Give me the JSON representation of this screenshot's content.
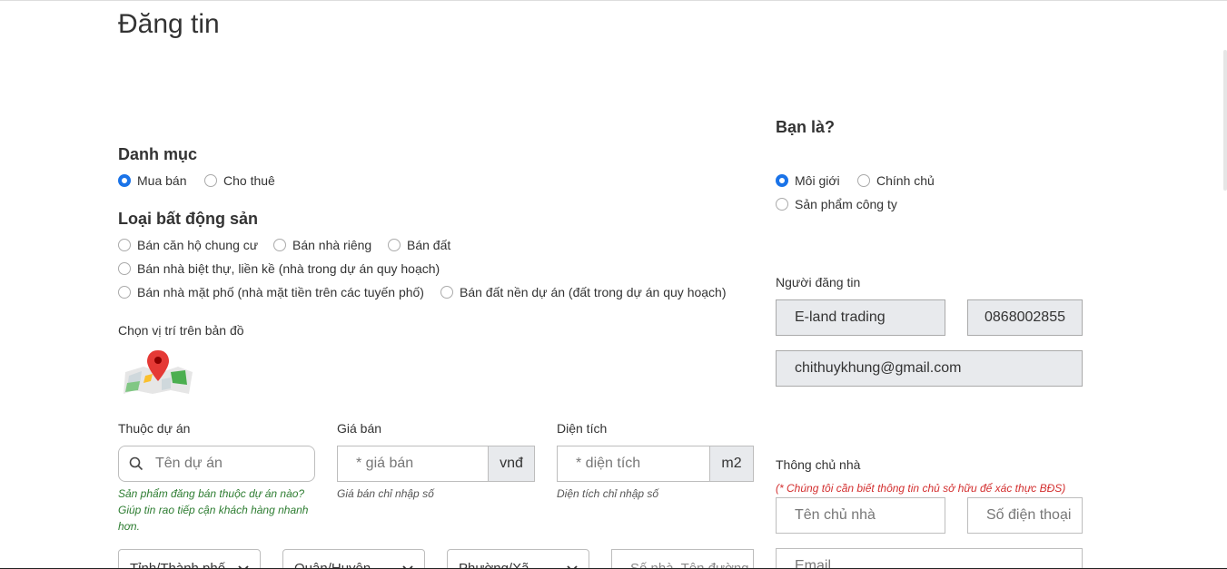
{
  "page": {
    "title": "Đăng tin"
  },
  "category": {
    "heading": "Danh mục",
    "options": [
      {
        "label": "Mua bán",
        "checked": true
      },
      {
        "label": "Cho thuê",
        "checked": false
      }
    ]
  },
  "property_type": {
    "heading": "Loại bất động sản",
    "options": [
      {
        "label": "Bán căn hộ chung cư",
        "checked": false
      },
      {
        "label": "Bán nhà riêng",
        "checked": false
      },
      {
        "label": "Bán đất",
        "checked": false
      },
      {
        "label": "Bán nhà biệt thự, liền kề (nhà trong dự án quy hoạch)",
        "checked": false
      },
      {
        "label": "Bán nhà mặt phố (nhà mặt tiền trên các tuyến phố)",
        "checked": false
      },
      {
        "label": "Bán đất nền dự án (đất trong dự án quy hoạch)",
        "checked": false
      }
    ]
  },
  "map": {
    "label": "Chọn vị trí trên bản đồ",
    "icon": "map-pin-icon"
  },
  "project": {
    "label": "Thuộc dự án",
    "placeholder": "Tên dự án",
    "hint": "Sản phẩm đăng bán thuộc dự án nào? Giúp tin rao tiếp cận khách hàng nhanh hơn."
  },
  "price": {
    "label": "Giá bán",
    "placeholder": "* giá bán",
    "unit": "vnđ",
    "hint": "Giá bán chỉ nhập số"
  },
  "area": {
    "label": "Diện tích",
    "placeholder": "* diện tích",
    "unit": "m2",
    "hint": "Diện tích chỉ nhập số"
  },
  "address": {
    "province": "Tỉnh/Thành phố",
    "district": "Quận/Huyện",
    "ward": "Phường/Xã",
    "street_placeholder": "Số nhà, Tên đường"
  },
  "role": {
    "heading": "Bạn là?",
    "options": [
      {
        "label": "Môi giới",
        "checked": true
      },
      {
        "label": "Chính chủ",
        "checked": false
      },
      {
        "label": "Sản phẩm công ty",
        "checked": false
      }
    ]
  },
  "poster": {
    "label": "Người đăng tin",
    "name": "E-land trading",
    "phone": "0868002855",
    "email": "chithuykhung@gmail.com"
  },
  "owner": {
    "label": "Thông chủ nhà",
    "note": "(* Chúng tôi cần biết thông tin chủ sở hữu để xác thực BĐS)",
    "name_placeholder": "Tên chủ nhà",
    "phone_placeholder": "Số điện thoại",
    "email_placeholder": "Email"
  },
  "colors": {
    "accent": "#1a73e8",
    "hint_green": "#2e7d32",
    "note_red": "#d32f2f",
    "field_gray": "#e8eaed"
  }
}
